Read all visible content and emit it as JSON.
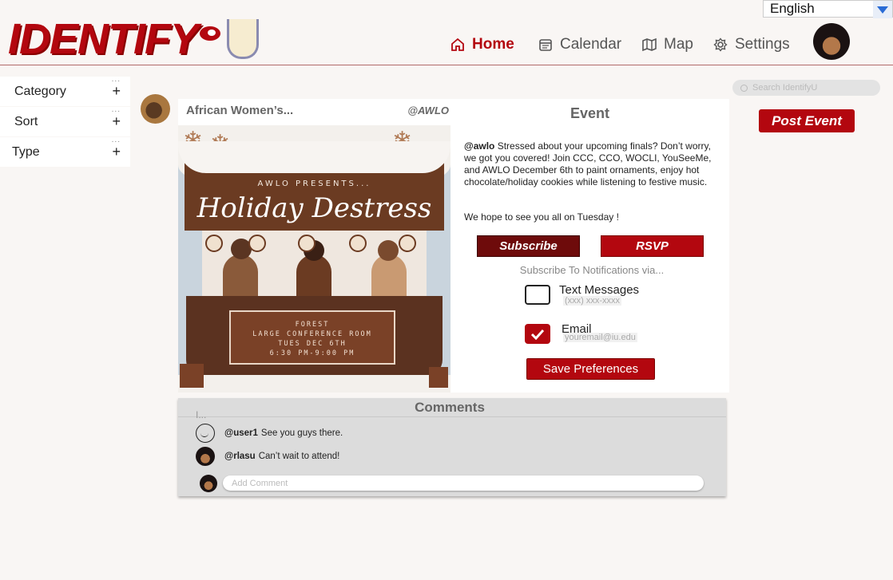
{
  "brand": {
    "logo_text": "IDENTIFY",
    "logo_suffix": "U",
    "accent": "#b3070f"
  },
  "language": {
    "selected": "English"
  },
  "nav": {
    "home": "Home",
    "calendar": "Calendar",
    "map": "Map",
    "settings": "Settings",
    "active": "home"
  },
  "filters": {
    "category": "Category",
    "sort": "Sort",
    "type": "Type",
    "expand_symbol": "+",
    "dots": "..."
  },
  "search": {
    "placeholder": "Search IdentifyU"
  },
  "post_button": "Post Event",
  "post": {
    "org_name": "African Women’s...",
    "org_handle": "@AWLO",
    "poster": {
      "presents": "AWLO PRESENTS...",
      "title": "Holiday Destress",
      "sign_lines": [
        "FOREST",
        "LARGE CONFERENCE ROOM",
        "TUES DEC 6TH",
        "6:30 PM-9:00 PM"
      ]
    },
    "event_label": "Event",
    "description_handle": "@awlo",
    "description": "Stressed about your upcoming finals? Don’t worry, we got you covered! Join CCC, CCO, WOCLI, YouSeeMe, and AWLO December 6th to paint ornaments, enjoy hot chocolate/holiday cookies while listening to festive music.",
    "description2": "We hope to see you all on Tuesday !",
    "subscribe_label": "Subscribe",
    "rsvp_label": "RSVP",
    "notify_label": "Subscribe To Notifications via...",
    "text_messages": {
      "label": "Text Messages",
      "placeholder": "(xxx) xxx-xxxx",
      "checked": false
    },
    "email": {
      "label": "Email",
      "placeholder": "youremail@iu.edu",
      "checked": true
    },
    "save_label": "Save Preferences"
  },
  "comments": {
    "title": "Comments",
    "cursor": "I...",
    "items": [
      {
        "user": "@user1",
        "text": "See you guys there."
      },
      {
        "user": "@rlasu",
        "text": "Can’t wait to attend!"
      }
    ],
    "add_placeholder": "Add Comment"
  }
}
